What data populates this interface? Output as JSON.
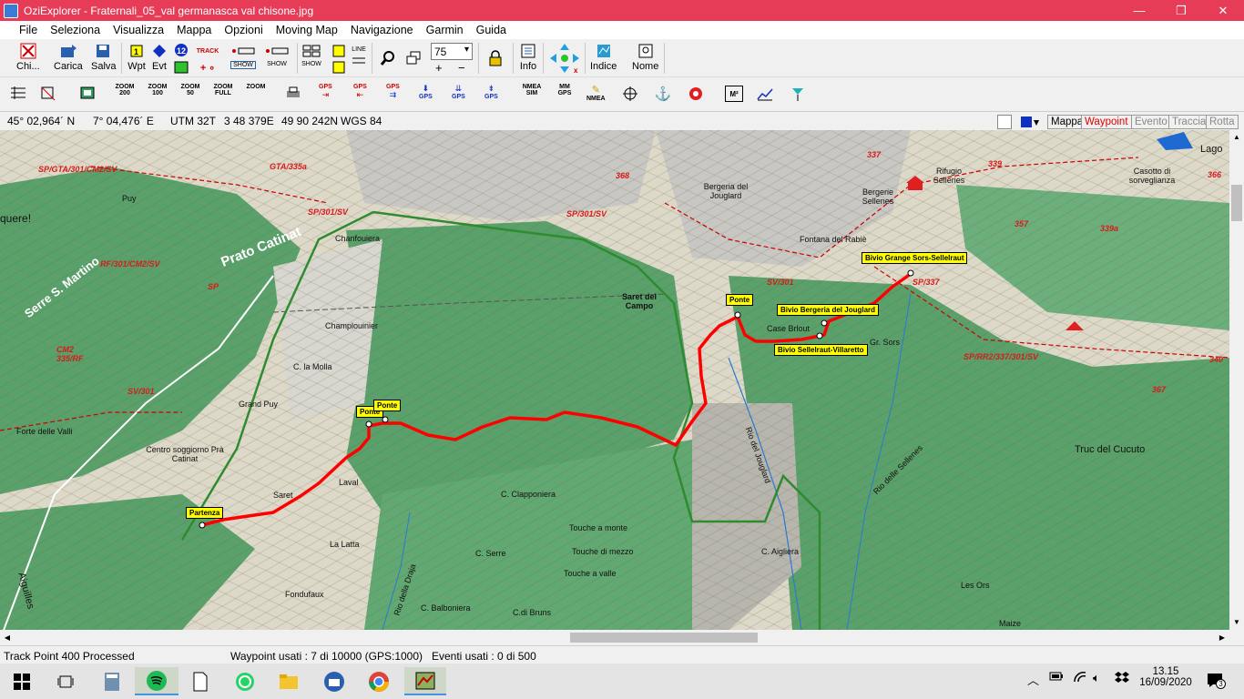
{
  "window": {
    "title": "OziExplorer - Fraternali_05_val germanasca val chisone.jpg",
    "minimize_glyph": "—",
    "restore_glyph": "❐",
    "close_glyph": "✕"
  },
  "menu": [
    "File",
    "Seleziona",
    "Visualizza",
    "Mappa",
    "Opzioni",
    "Moving Map",
    "Navigazione",
    "Garmin",
    "Guida"
  ],
  "toolbar1": {
    "close_label": "Chi...",
    "load_label": "Carica",
    "save_label": "Salva",
    "wpt_label": "Wpt",
    "evt_label": "Evt",
    "track_label": "TRACK",
    "show_label": "SHOW",
    "line_label": "LINE",
    "zoom_value": "75",
    "info_label": "Info",
    "index_label": "Indice",
    "name_label": "Nome",
    "plus_glyph": "+",
    "minus_glyph": "−"
  },
  "toolbar2": {
    "zoom200": "ZOOM 200",
    "zoom100": "ZOOM 100",
    "zoom50": "ZOOM 50",
    "zoomfull": "ZOOM FULL",
    "zoom": "ZOOM",
    "gps": "GPS",
    "nmea_sim": "NMEA SIM",
    "mm_gps": "MM GPS",
    "nmea": "NMEA",
    "m2": "M²"
  },
  "coords": {
    "lat": "45° 02,964´ N",
    "lon": "7° 04,476´ E",
    "utm": "UTM  32T",
    "easting": "3 48 379E",
    "northing": "49 90 242N",
    "datum": "WGS 84"
  },
  "mode_buttons": [
    "Mappa",
    "Waypoint",
    "Evento",
    "Traccia",
    "Rotta"
  ],
  "waypoints": [
    {
      "label": "Partenza"
    },
    {
      "label": "Ponte"
    },
    {
      "label": "Ponte"
    },
    {
      "label": "Ponte"
    },
    {
      "label": "Bivio Bergeria del Jouglard"
    },
    {
      "label": "Bivio Sellelraut-Villaretto"
    },
    {
      "label": "Bivio Grange Sors-Sellelraut"
    }
  ],
  "map_labels": [
    "Puy",
    "Prato Catinat",
    "Serre S. Martino",
    "Chanfouiera",
    "Champlouinier",
    "C. la Molla",
    "Grand Puy",
    "Forte delle Valli",
    "Centro soggiorno Prà Catinat",
    "Saret",
    "Laval",
    "La Latta",
    "Fondufaux",
    "C. Clapponiera",
    "Touche a monte",
    "Touche di mezzo",
    "Touche a valle",
    "C. Serre",
    "C. Balboniera",
    "C.di Bruns",
    "Rio della Draja",
    "Saret del Campo",
    "Bergeria del Jouglard",
    "Fontana del Rabiè",
    "Bergerie Sellenes",
    "Rifugio Selleries",
    "Casotto di sorveglianza",
    "Lago",
    "Case Brlout",
    "Gr. Sors",
    "Rio del Jouglard",
    "C. Aigliera",
    "Rio delle Sellenes",
    "Truc del Cucuto",
    "Les Ors",
    "Maize",
    "Aiguilles",
    "quere!"
  ],
  "map_trail_labels": [
    "SP/GTA/301/CM2/SV",
    "GTA/335a",
    "SP/301/SV",
    "RF/301/CM2/SV",
    "SP",
    "CM2 335/RF",
    "SV/301",
    "SP/301/SV",
    "SV/301",
    "SP/337",
    "SP/RR2/337/301/SV",
    "339",
    "339a",
    "357",
    "368",
    "337",
    "340",
    "367",
    "366"
  ],
  "status": {
    "left": "Track Point 400 Processed",
    "waypoints": "Waypoint usati : 7 di 10000  (GPS:1000)",
    "events": "Eventi usati : 0 di 500"
  },
  "taskbar": {
    "time": "13.15",
    "date": "16/09/2020",
    "notif_count": "3"
  },
  "colors": {
    "titlebar": "#e73c57",
    "track": "#ff0000",
    "route_green": "#2e8b2e",
    "waypoint_fill": "#ffff00",
    "map_forest": "#5aa06a",
    "map_rock": "#c9c7c3"
  }
}
